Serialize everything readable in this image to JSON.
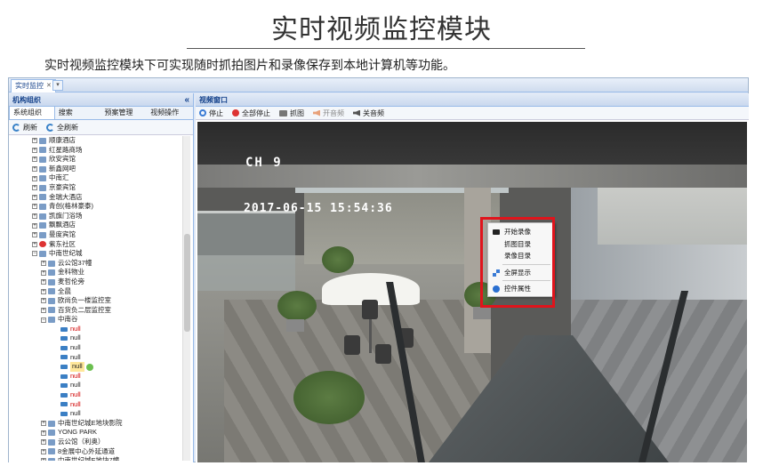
{
  "slide": {
    "title": "实时视频监控模块",
    "description": "实时视频监控模块下可实现随时抓拍图片和录像保存到本地计算机等功能。"
  },
  "app": {
    "tab_label": "实时监控",
    "left_panel": {
      "title": "机构组织",
      "collapse_icon": "«",
      "tabs": [
        "系统组织",
        "搜索",
        "预案管理",
        "视频操作"
      ],
      "active_tab": "系统组织",
      "toolbar": {
        "refresh": "刷新",
        "refresh_all": "全刷新"
      },
      "tree": [
        {
          "label": "顺康酒店",
          "level": 1,
          "type": "folder"
        },
        {
          "label": "红星路商场",
          "level": 1,
          "type": "folder"
        },
        {
          "label": "欣安宾馆",
          "level": 1,
          "type": "folder"
        },
        {
          "label": "新鑫网吧",
          "level": 1,
          "type": "folder"
        },
        {
          "label": "中南汇",
          "level": 1,
          "type": "folder"
        },
        {
          "label": "京豪宾馆",
          "level": 1,
          "type": "folder"
        },
        {
          "label": "金瑞大酒店",
          "level": 1,
          "type": "folder"
        },
        {
          "label": "青创(格林豪泰)",
          "level": 1,
          "type": "folder"
        },
        {
          "label": "凯旗门浴场",
          "level": 1,
          "type": "folder"
        },
        {
          "label": "飘飘酒店",
          "level": 1,
          "type": "folder"
        },
        {
          "label": "曼度宾馆",
          "level": 1,
          "type": "folder"
        },
        {
          "label": "紫东社区",
          "level": 1,
          "type": "special"
        },
        {
          "label": "中南世纪城",
          "level": 1,
          "type": "folder",
          "expanded": true
        },
        {
          "label": "云公馆37幢",
          "level": 2,
          "type": "folder"
        },
        {
          "label": "金科物业",
          "level": 2,
          "type": "folder"
        },
        {
          "label": "麦哲伦旁",
          "level": 2,
          "type": "folder"
        },
        {
          "label": "全晨",
          "level": 2,
          "type": "folder"
        },
        {
          "label": "欧尚负一楼监控室",
          "level": 2,
          "type": "folder"
        },
        {
          "label": "百货负二层监控室",
          "level": 2,
          "type": "folder"
        },
        {
          "label": "中南谷",
          "level": 2,
          "type": "folder",
          "expanded": true
        },
        {
          "label": "null",
          "level": 3,
          "type": "cam",
          "status": "offline"
        },
        {
          "label": "null",
          "level": 3,
          "type": "cam",
          "status": "online"
        },
        {
          "label": "null",
          "level": 3,
          "type": "cam",
          "status": "online"
        },
        {
          "label": "null",
          "level": 3,
          "type": "cam",
          "status": "online"
        },
        {
          "label": "null",
          "level": 3,
          "type": "cam",
          "status": "selected"
        },
        {
          "label": "null",
          "level": 3,
          "type": "cam",
          "status": "offline"
        },
        {
          "label": "null",
          "level": 3,
          "type": "cam",
          "status": "online"
        },
        {
          "label": "null",
          "level": 3,
          "type": "cam",
          "status": "offline"
        },
        {
          "label": "null",
          "level": 3,
          "type": "cam",
          "status": "offline"
        },
        {
          "label": "null",
          "level": 3,
          "type": "cam",
          "status": "online"
        },
        {
          "label": "中南世纪城E地块影院",
          "level": 2,
          "type": "folder"
        },
        {
          "label": "YONG PARK",
          "level": 2,
          "type": "folder"
        },
        {
          "label": "云公馆（利奥）",
          "level": 2,
          "type": "folder"
        },
        {
          "label": "8金展中心外延通道",
          "level": 2,
          "type": "folder"
        },
        {
          "label": "中南世纪城E地块7幢",
          "level": 2,
          "type": "folder"
        }
      ]
    },
    "video_panel": {
      "title": "视频窗口",
      "toolbar": [
        {
          "label": "停止",
          "icon": "stop-icon",
          "enabled": true
        },
        {
          "label": "全部停止",
          "icon": "stop-all-icon",
          "enabled": true
        },
        {
          "label": "抓图",
          "icon": "snapshot-icon",
          "enabled": true
        },
        {
          "label": "开音频",
          "icon": "sound-icon",
          "enabled": false
        },
        {
          "label": "关音频",
          "icon": "mute-icon",
          "enabled": true
        }
      ],
      "osd_channel": "CH 9",
      "osd_time": "2017-06-15 15:54:36",
      "context_menu": [
        {
          "label": "开始录像",
          "icon": "record-icon"
        },
        {
          "label": "抓图目录",
          "icon": ""
        },
        {
          "label": "录像目录",
          "icon": ""
        },
        {
          "label": "全屏显示",
          "icon": "fullscreen-icon"
        },
        {
          "label": "控件属性",
          "icon": "info-icon"
        }
      ]
    }
  },
  "colors": {
    "accent": "#15428b",
    "highlight_box": "#e0141c",
    "offline": "#d00000"
  }
}
